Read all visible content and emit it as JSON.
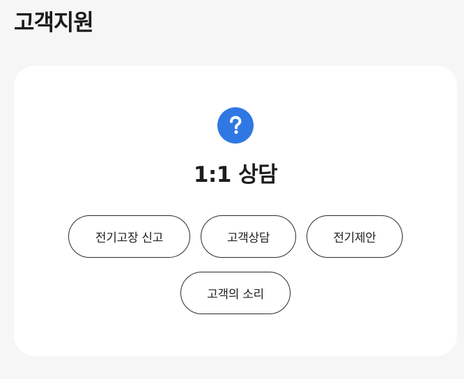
{
  "header": {
    "title": "고객지원"
  },
  "card": {
    "icon": "question-mark-icon",
    "title": "1:1 상담",
    "buttons": [
      {
        "label": "전기고장 신고"
      },
      {
        "label": "고객상담"
      },
      {
        "label": "전기제안"
      },
      {
        "label": "고객의 소리"
      }
    ]
  },
  "colors": {
    "background": "#f6f6f6",
    "card": "#ffffff",
    "accent": "#2f78e3",
    "text": "#1f1f1f"
  }
}
